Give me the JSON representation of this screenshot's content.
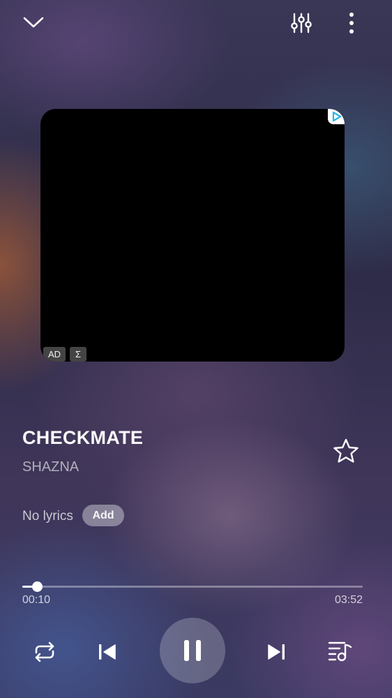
{
  "header": {
    "collapse_icon": "chevron-down-icon",
    "equalizer_icon": "equalizer-sliders-icon",
    "more_icon": "more-vertical-icon"
  },
  "ad": {
    "ad_label": "AD",
    "sigma_label": "Σ",
    "adchoices_icon": "adchoices-icon"
  },
  "track": {
    "title": "CHECKMATE",
    "artist": "SHAZNA",
    "favorite_icon": "star-outline-icon"
  },
  "lyrics": {
    "status": "No lyrics",
    "add_label": "Add"
  },
  "playback": {
    "elapsed": "00:10",
    "duration": "03:52",
    "progress_fraction": 0.0431
  },
  "controls": {
    "repeat_icon": "repeat-icon",
    "previous_icon": "skip-previous-icon",
    "pause_icon": "pause-icon",
    "next_icon": "skip-next-icon",
    "queue_icon": "playlist-music-icon"
  },
  "colors": {
    "text_primary": "#fafafa",
    "ad_background": "#000000"
  }
}
